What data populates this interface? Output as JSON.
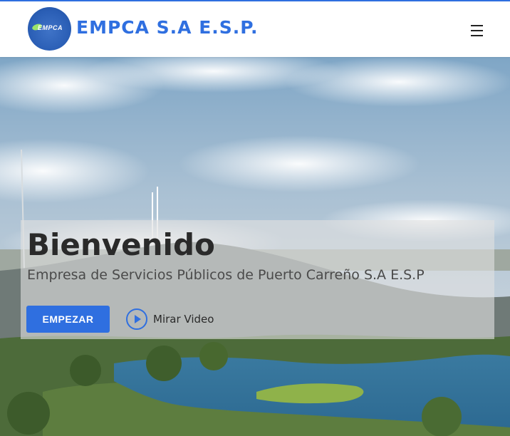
{
  "header": {
    "logo_text": "EMPCA",
    "brand": "EMPCA S.A E.S.P.",
    "menu_icon": "hamburger-menu-icon"
  },
  "hero": {
    "title": "Bienvenido",
    "subtitle": "Empresa de Servicios Públicos de Puerto Carreño S.A E.S.P",
    "start_button": "EMPEZAR",
    "video_link": "Mirar Video",
    "video_icon": "play-circle-icon"
  },
  "colors": {
    "accent": "#2f6fe0",
    "title": "#2a2a2a",
    "subtitle": "#4a4a4a"
  }
}
